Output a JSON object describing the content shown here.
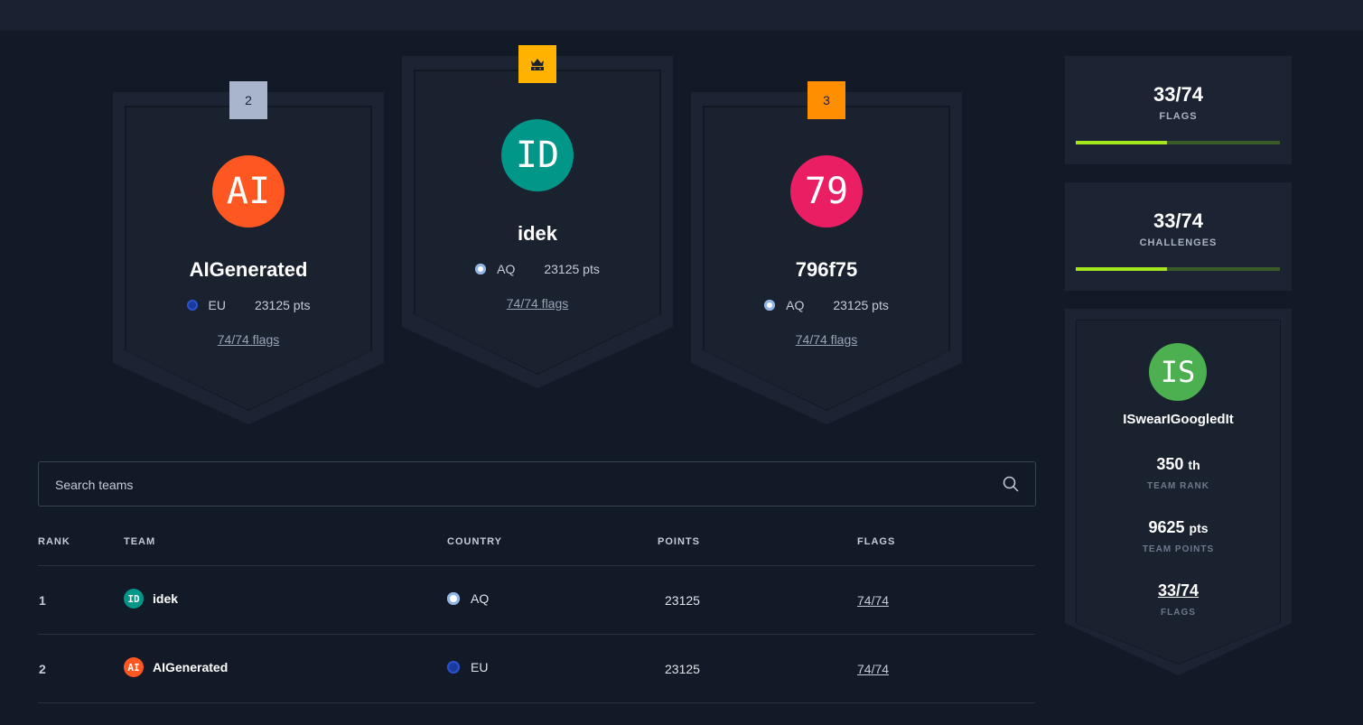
{
  "podium": [
    {
      "place": "2",
      "initials": "AI",
      "avatar_color": "#ff5722",
      "name": "AIGenerated",
      "country": "EU",
      "country_flag_color": "#1a3aa0",
      "points": "23125 pts",
      "flags": "74/74 flags",
      "badge_color": "#a9b4cd"
    },
    {
      "place_icon": "crown-icon",
      "initials": "ID",
      "avatar_color": "#009688",
      "name": "idek",
      "country": "AQ",
      "country_flag_color": "#ffffff",
      "points": "23125 pts",
      "flags": "74/74 flags",
      "badge_color": "#ffb300"
    },
    {
      "place": "3",
      "initials": "79",
      "avatar_color": "#e91e63",
      "name": "796f75",
      "country": "AQ",
      "country_flag_color": "#ffffff",
      "points": "23125 pts",
      "flags": "74/74 flags",
      "badge_color": "#ff8f00"
    }
  ],
  "search": {
    "placeholder": "Search teams",
    "icon": "search-icon"
  },
  "table": {
    "headers": {
      "rank": "RANK",
      "team": "TEAM",
      "country": "COUNTRY",
      "points": "POINTS",
      "flags": "FLAGS"
    },
    "rows": [
      {
        "rank": "1",
        "initials": "ID",
        "avatar_color": "#009688",
        "team": "idek",
        "country": "AQ",
        "points": "23125",
        "flags": "74/74"
      },
      {
        "rank": "2",
        "initials": "AI",
        "avatar_color": "#ff5722",
        "team": "AIGenerated",
        "country": "EU",
        "points": "23125",
        "flags": "74/74"
      }
    ]
  },
  "stats": {
    "flags": {
      "value": "33/74",
      "label": "FLAGS",
      "progress": 0.446
    },
    "challenges": {
      "value": "33/74",
      "label": "CHALLENGES",
      "progress": 0.446
    }
  },
  "my_team": {
    "initials": "IS",
    "avatar_color": "#4caf50",
    "name": "ISwearIGoogledIt",
    "rank": "350",
    "rank_suffix": "th",
    "rank_label": "TEAM RANK",
    "points": "9625",
    "points_suffix": "pts",
    "points_label": "TEAM POINTS",
    "flags": "33/74",
    "flags_label": "FLAGS"
  },
  "colors": {
    "accent": "#a4e61c",
    "bg": "#131a27",
    "panel": "#1c2433"
  }
}
